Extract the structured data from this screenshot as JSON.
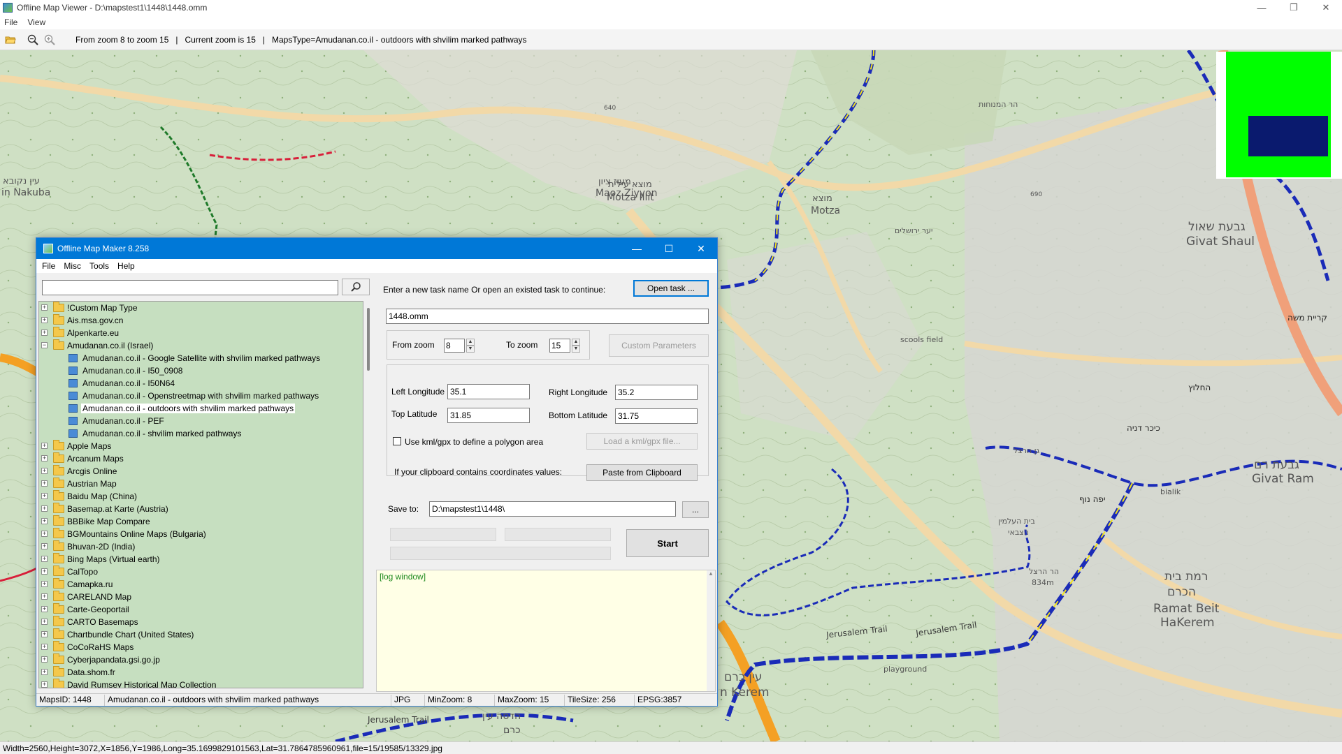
{
  "viewer": {
    "title": "Offline Map Viewer - D:\\mapstest1\\1448\\1448.omm",
    "menu": [
      "File",
      "View"
    ],
    "window_controls": {
      "minimize": "—",
      "maximize": "❐",
      "close": "✕"
    },
    "toolbar": {
      "icons": [
        "open-folder-icon",
        "zoom-out-icon",
        "zoom-in-icon"
      ],
      "status": "From zoom 8 to zoom 15   |   Current zoom is 15   |   MapsType=Amudanan.co.il - outdoors with shvilim marked pathways"
    },
    "statusbar": "Width=2560,Height=3072,X=1856,Y=1986,Long=35.1699829101563,Lat=31.7864785960961,file=15/19585/13329.jpg"
  },
  "map": {
    "labels": [
      {
        "text": "הר המנוחות",
        "id": "har-hamenuchot"
      },
      {
        "text": "מעוז ציון",
        "id": "maoz-ziyon-he"
      },
      {
        "text": "Maoz Ziyyon",
        "id": "maoz-ziyyon"
      },
      {
        "text": "מוצא עילית",
        "id": "motza-illit-he"
      },
      {
        "text": "Motza Illit",
        "id": "motza-illit"
      },
      {
        "text": "מוצא",
        "id": "motza-he"
      },
      {
        "text": "Motza",
        "id": "motza"
      },
      {
        "text": "גבעת שאול",
        "id": "givat-shaul-he"
      },
      {
        "text": "Givat Shaul",
        "id": "givat-shaul"
      },
      {
        "text": "עין נקובא",
        "id": "ein-nakuba-he"
      },
      {
        "text": "in Nakuba",
        "id": "ein-nakuba"
      },
      {
        "text": "קריית משה",
        "id": "kiryat-moshe"
      },
      {
        "text": "scools field",
        "id": "scools-field"
      },
      {
        "text": "החלוץ",
        "id": "hechalutz"
      },
      {
        "text": "כיכר דניה",
        "id": "kikar-denya"
      },
      {
        "text": "גבעת רם",
        "id": "givat-ram-he"
      },
      {
        "text": "Givat Ram",
        "id": "givat-ram"
      },
      {
        "text": "bialik",
        "id": "bialik"
      },
      {
        "text": "יפה נוף",
        "id": "yefe-nof"
      },
      {
        "text": "רמת בית",
        "id": "ramat-beit-he"
      },
      {
        "text": "הכרם",
        "id": "hakerem-he"
      },
      {
        "text": "Ramat Beit",
        "id": "ramat-beit"
      },
      {
        "text": "HaKerem",
        "id": "hakerem"
      },
      {
        "text": "הר הרצל",
        "id": "har-herzl-he"
      },
      {
        "text": "834m",
        "id": "elev-834"
      },
      {
        "text": "Jerusalem Trail",
        "id": "jerusalem-trail-1"
      },
      {
        "text": "Jerusalem Trail",
        "id": "jerusalem-trail-2"
      },
      {
        "text": "Jerusalem Trail",
        "id": "jerusalem-trail-3"
      },
      {
        "text": "playground",
        "id": "playground"
      },
      {
        "text": "עין כרם",
        "id": "ein-karem-he"
      },
      {
        "text": "n Kerem",
        "id": "ein-karem"
      },
      {
        "text": "הדסה עין",
        "id": "hadassah-he"
      },
      {
        "text": "כרם",
        "id": "karem-he"
      },
      {
        "text": "בית העלמין",
        "id": "cemetery-he"
      },
      {
        "text": "הצבאי",
        "id": "military-he"
      },
      {
        "text": "גן הרצל",
        "id": "gan-herzl"
      },
      {
        "text": "יער ירושלים",
        "id": "jerusalem-forest"
      },
      {
        "text": "640",
        "id": "elev-640"
      },
      {
        "text": "690",
        "id": "elev-690"
      }
    ]
  },
  "dialog": {
    "title": "Offline Map Maker 8.258",
    "window_controls": {
      "minimize": "—",
      "maximize": "☐",
      "close": "✕"
    },
    "menu": [
      "File",
      "Misc",
      "Tools",
      "Help"
    ],
    "search": {
      "value": "",
      "placeholder": ""
    },
    "tree": [
      {
        "label": "!Custom Map Type",
        "expanded": false
      },
      {
        "label": "Ais.msa.gov.cn",
        "expanded": false
      },
      {
        "label": "Alpenkarte.eu",
        "expanded": false
      },
      {
        "label": "Amudanan.co.il (Israel)",
        "expanded": true,
        "children": [
          {
            "label": "Amudanan.co.il - Google Satellite with shvilim marked pathways"
          },
          {
            "label": "Amudanan.co.il - I50_0908"
          },
          {
            "label": "Amudanan.co.il - I50N64"
          },
          {
            "label": "Amudanan.co.il - Openstreetmap with shvilim marked pathways"
          },
          {
            "label": "Amudanan.co.il - outdoors with shvilim marked pathways",
            "selected": true
          },
          {
            "label": "Amudanan.co.il - PEF"
          },
          {
            "label": "Amudanan.co.il - shvilim marked pathways"
          }
        ]
      },
      {
        "label": "Apple Maps",
        "expanded": false
      },
      {
        "label": "Arcanum Maps",
        "expanded": false
      },
      {
        "label": "Arcgis Online",
        "expanded": false
      },
      {
        "label": "Austrian Map",
        "expanded": false
      },
      {
        "label": "Baidu Map (China)",
        "expanded": false
      },
      {
        "label": "Basemap.at Karte (Austria)",
        "expanded": false
      },
      {
        "label": "BBBike Map Compare",
        "expanded": false
      },
      {
        "label": "BGMountains Online Maps (Bulgaria)",
        "expanded": false
      },
      {
        "label": "Bhuvan-2D (India)",
        "expanded": false
      },
      {
        "label": "Bing Maps (Virtual earth)",
        "expanded": false
      },
      {
        "label": "CalTopo",
        "expanded": false
      },
      {
        "label": "Camapka.ru",
        "expanded": false
      },
      {
        "label": "CARELAND Map",
        "expanded": false
      },
      {
        "label": "Carte-Geoportail",
        "expanded": false
      },
      {
        "label": "CARTO Basemaps",
        "expanded": false
      },
      {
        "label": "Chartbundle Chart (United States)",
        "expanded": false
      },
      {
        "label": "CoCoRaHS Maps",
        "expanded": false
      },
      {
        "label": "Cyberjapandata.gsi.go.jp",
        "expanded": false
      },
      {
        "label": "Data.shom.fr",
        "expanded": false
      },
      {
        "label": "David Rumsey Historical Map Collection",
        "expanded": false
      }
    ],
    "task": {
      "prompt": "Enter a new task name Or open an existed task to continue:",
      "open_button": "Open task ...",
      "name_value": "1448.omm"
    },
    "zoom": {
      "from_label": "From zoom",
      "from_value": "8",
      "to_label": "To zoom",
      "to_value": "15",
      "custom_button": "Custom Parameters"
    },
    "coords": {
      "left_lon_label": "Left Longitude",
      "left_lon": "35.1",
      "right_lon_label": "Right Longitude",
      "right_lon": "35.2",
      "top_lat_label": "Top Latitude",
      "top_lat": "31.85",
      "bottom_lat_label": "Bottom Latitude",
      "bottom_lat": "31.75",
      "kml_checkbox_label": "Use kml/gpx to define a polygon area",
      "kml_checked": false,
      "load_kml_button": "Load a kml/gpx file...",
      "clipboard_label": "If your clipboard contains coordinates values:",
      "paste_button": "Paste from Clipboard"
    },
    "save": {
      "label": "Save to:",
      "value": "D:\\mapstest1\\1448\\",
      "browse_button": "...",
      "start_button": "Start"
    },
    "log": {
      "text": "[log window]"
    },
    "status": {
      "maps_id": "MapsID: 1448",
      "map_name": "Amudanan.co.il - outdoors with shvilim marked pathways",
      "format": "JPG",
      "min_zoom": "MinZoom: 8",
      "max_zoom": "MaxZoom: 15",
      "tile_size": "TileSize: 256",
      "epsg": "EPSG:3857"
    }
  },
  "colors": {
    "dialog_title_bg": "#0078d7",
    "tree_bg": "#c6dfc0",
    "log_bg": "#ffffe6",
    "log_text": "#1f8a1f",
    "overview_green": "#00ff00",
    "overview_blue": "#0a1a6e",
    "trail_blue": "#1a2bb8",
    "trail_yellow": "#f2e21a",
    "trail_red": "#d81f3a",
    "trail_green": "#1f7a2a",
    "road_orange": "#f4a024"
  }
}
